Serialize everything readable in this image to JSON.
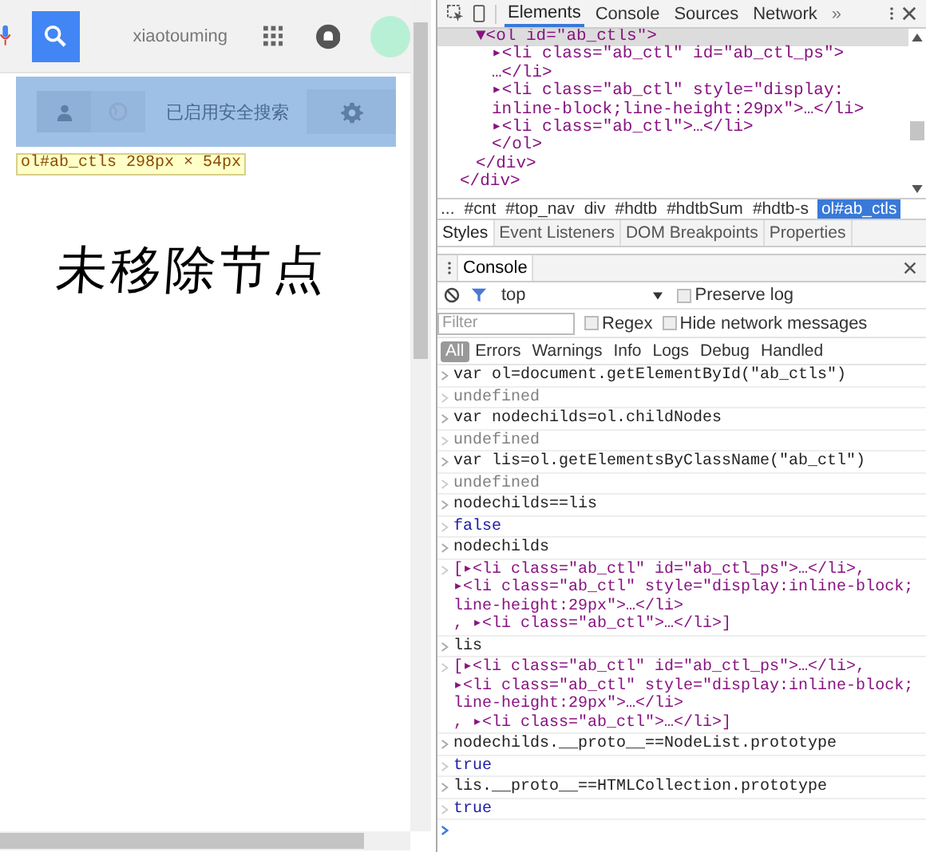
{
  "page": {
    "username": "xiaotouming",
    "safe_search_label": "已启用安全搜索",
    "tooltip": "ol#ab_ctls 298px × 54px",
    "annotation": "未移除节点"
  },
  "devtools": {
    "tabs": [
      {
        "label": "Elements",
        "selected": true
      },
      {
        "label": "Console",
        "selected": false
      },
      {
        "label": "Sources",
        "selected": false
      },
      {
        "label": "Network",
        "selected": false
      }
    ],
    "more_tabs": "»",
    "tree_lines": [
      {
        "text": "▼<ol id=\"ab_ctls\">",
        "selected": true,
        "children": [
          {
            "text": "▸<li class=\"ab_ctl\" id=\"ab_ctl_ps\">",
            "selected": false
          },
          {
            "text": "…</li>",
            "selected": false
          },
          {
            "text": "▸<li class=\"ab_ctl\" style=\"display:",
            "selected": false
          },
          {
            "text": "inline-block;line-height:29px\">…</li>",
            "selected": false
          },
          {
            "text": "▸<li class=\"ab_ctl\">…</li>",
            "selected": false
          },
          {
            "text": "</ol>",
            "selected": false
          }
        ]
      },
      {
        "text": "</div>",
        "selected": false
      }
    ],
    "tree_outer_closing": "</div>",
    "breadcrumbs": [
      {
        "label": "...",
        "selected": false
      },
      {
        "label": "#cnt",
        "selected": false
      },
      {
        "label": "#top_nav",
        "selected": false
      },
      {
        "label": "div",
        "selected": false
      },
      {
        "label": "#hdtb",
        "selected": false
      },
      {
        "label": "#hdtbSum",
        "selected": false
      },
      {
        "label": "#hdtb-s",
        "selected": false
      },
      {
        "label": "ol#ab_ctls",
        "selected": true
      }
    ],
    "sub_tabs": [
      {
        "label": "Styles",
        "selected": true
      },
      {
        "label": "Event Listeners",
        "selected": false
      },
      {
        "label": "DOM Breakpoints",
        "selected": false
      },
      {
        "label": "Properties",
        "selected": false
      }
    ],
    "drawer_tab": "Console",
    "context": "top",
    "preserve_log": {
      "label": "Preserve log",
      "checked": false
    },
    "filter": {
      "placeholder": "Filter"
    },
    "regex": {
      "label": "Regex",
      "checked": false
    },
    "hide_network": {
      "label": "Hide network messages",
      "checked": false
    },
    "levels": [
      {
        "label": "All",
        "selected": true
      },
      {
        "label": "Errors",
        "selected": false
      },
      {
        "label": "Warnings",
        "selected": false
      },
      {
        "label": "Info",
        "selected": false
      },
      {
        "label": "Logs",
        "selected": false
      },
      {
        "label": "Debug",
        "selected": false
      },
      {
        "label": "Handled",
        "selected": false
      }
    ],
    "console": [
      {
        "kind": "input",
        "lines": [
          "var ol=document.getElementById(\"ab_ctls\")"
        ]
      },
      {
        "kind": "undefined",
        "lines": [
          "undefined"
        ]
      },
      {
        "kind": "input",
        "lines": [
          "var nodechilds=ol.childNodes"
        ]
      },
      {
        "kind": "undefined",
        "lines": [
          "undefined"
        ]
      },
      {
        "kind": "input",
        "lines": [
          "var lis=ol.getElementsByClassName(\"ab_ctl\")"
        ]
      },
      {
        "kind": "undefined",
        "lines": [
          "undefined"
        ]
      },
      {
        "kind": "input",
        "lines": [
          "nodechilds==lis"
        ]
      },
      {
        "kind": "boolean",
        "lines": [
          "false"
        ]
      },
      {
        "kind": "input",
        "lines": [
          "nodechilds"
        ]
      },
      {
        "kind": "nodes",
        "lines": [
          "[▸<li class=\"ab_ctl\" id=\"ab_ctl_ps\">…</li>,",
          "▸<li class=\"ab_ctl\" style=\"display:inline-block;",
          "line-height:29px\">…</li>",
          ", ▸<li class=\"ab_ctl\">…</li>]"
        ]
      },
      {
        "kind": "input",
        "lines": [
          "lis"
        ]
      },
      {
        "kind": "nodes",
        "lines": [
          "[▸<li class=\"ab_ctl\" id=\"ab_ctl_ps\">…</li>,",
          "▸<li class=\"ab_ctl\" style=\"display:inline-block;",
          "line-height:29px\">…</li>",
          ", ▸<li class=\"ab_ctl\">…</li>]"
        ]
      },
      {
        "kind": "input",
        "lines": [
          "nodechilds.__proto__==NodeList.prototype"
        ]
      },
      {
        "kind": "boolean",
        "lines": [
          "true"
        ]
      },
      {
        "kind": "input",
        "lines": [
          "lis.__proto__==HTMLCollection.prototype"
        ]
      },
      {
        "kind": "boolean",
        "lines": [
          "true"
        ]
      }
    ]
  }
}
